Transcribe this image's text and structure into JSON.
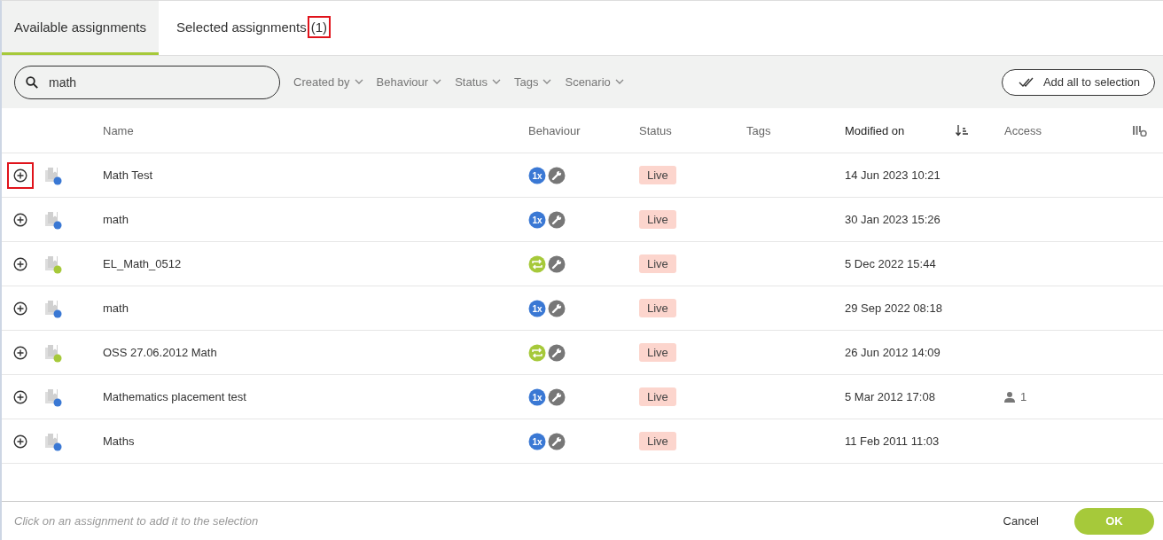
{
  "tabs": [
    {
      "label": "Available assignments",
      "selected": true
    },
    {
      "label": "Selected assignments",
      "count": "(1)",
      "count_highlighted": true,
      "selected": false
    }
  ],
  "search": {
    "value": "math"
  },
  "filters": [
    "Created by",
    "Behaviour",
    "Status",
    "Tags",
    "Scenario"
  ],
  "add_all_button": "Add all to selection",
  "table": {
    "columns": [
      {
        "label": "Name",
        "sorted": false
      },
      {
        "label": "Behaviour",
        "sorted": false
      },
      {
        "label": "Status",
        "sorted": false
      },
      {
        "label": "Tags",
        "sorted": false
      },
      {
        "label": "Modified on",
        "sorted": true
      },
      {
        "label": "Access",
        "sorted": false
      }
    ],
    "rows": [
      {
        "name": "Math Test",
        "behaviour": {
          "kind": "once",
          "label": "1x"
        },
        "status": "Live",
        "modified": "14 Jun 2023 10:21",
        "highlighted": true
      },
      {
        "name": "math",
        "behaviour": {
          "kind": "once",
          "label": "1x"
        },
        "status": "Live",
        "modified": "30 Jan 2023 15:26",
        "highlighted": false
      },
      {
        "name": "EL_Math_0512",
        "behaviour": {
          "kind": "repeat"
        },
        "status": "Live",
        "modified": "5 Dec 2022 15:44",
        "highlighted": false
      },
      {
        "name": "math",
        "behaviour": {
          "kind": "once",
          "label": "1x"
        },
        "status": "Live",
        "modified": "29 Sep 2022 08:18",
        "highlighted": false
      },
      {
        "name": "OSS 27.06.2012 Math",
        "behaviour": {
          "kind": "repeat"
        },
        "status": "Live",
        "modified": "26 Jun 2012 14:09",
        "highlighted": false
      },
      {
        "name": "Mathematics placement test",
        "behaviour": {
          "kind": "once",
          "label": "1x"
        },
        "status": "Live",
        "modified": "5 Mar 2012 17:08",
        "access": "1",
        "highlighted": false
      },
      {
        "name": "Maths",
        "behaviour": {
          "kind": "once",
          "label": "1x"
        },
        "status": "Live",
        "modified": "11 Feb 2011 11:03",
        "highlighted": false
      }
    ]
  },
  "footer": {
    "hint": "Click on an assignment to add it to the selection",
    "cancel": "Cancel",
    "ok": "OK"
  }
}
